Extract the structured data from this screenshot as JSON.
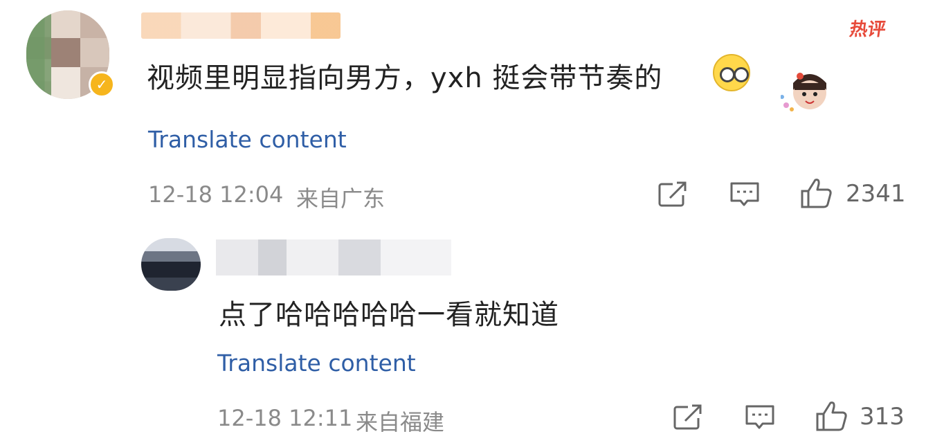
{
  "comment": {
    "hot_label": "热评",
    "text": "视频里明显指向男方，yxh 挺会带节奏的",
    "translate_label": "Translate content",
    "date": "12-18 12:04",
    "location": "来自广东",
    "like_count": "2341",
    "icons": [
      "share-icon",
      "comment-icon",
      "like-icon",
      "verified-badge-icon",
      "emoji-glasses-icon"
    ]
  },
  "reply": {
    "text": "点了哈哈哈哈哈一看就知道",
    "translate_label": "Translate content",
    "date": "12-18 12:11",
    "location": "来自福建",
    "like_count": "313",
    "icons": [
      "share-icon",
      "comment-icon",
      "like-icon"
    ]
  },
  "colors": {
    "link": "#2f5ea6",
    "meta": "#8a8a8a",
    "hot": "#e74a3a",
    "verified": "#f6b51d"
  }
}
